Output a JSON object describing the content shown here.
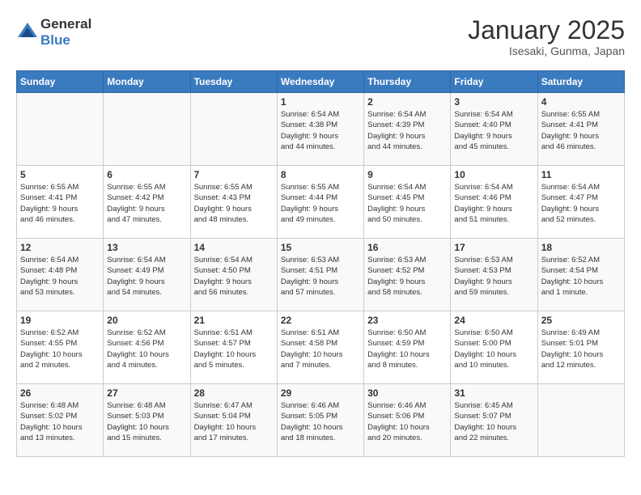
{
  "header": {
    "logo_general": "General",
    "logo_blue": "Blue",
    "title": "January 2025",
    "subtitle": "Isesaki, Gunma, Japan"
  },
  "calendar": {
    "days_of_week": [
      "Sunday",
      "Monday",
      "Tuesday",
      "Wednesday",
      "Thursday",
      "Friday",
      "Saturday"
    ],
    "weeks": [
      [
        {
          "day": "",
          "content": ""
        },
        {
          "day": "",
          "content": ""
        },
        {
          "day": "",
          "content": ""
        },
        {
          "day": "1",
          "content": "Sunrise: 6:54 AM\nSunset: 4:38 PM\nDaylight: 9 hours\nand 44 minutes."
        },
        {
          "day": "2",
          "content": "Sunrise: 6:54 AM\nSunset: 4:39 PM\nDaylight: 9 hours\nand 44 minutes."
        },
        {
          "day": "3",
          "content": "Sunrise: 6:54 AM\nSunset: 4:40 PM\nDaylight: 9 hours\nand 45 minutes."
        },
        {
          "day": "4",
          "content": "Sunrise: 6:55 AM\nSunset: 4:41 PM\nDaylight: 9 hours\nand 46 minutes."
        }
      ],
      [
        {
          "day": "5",
          "content": "Sunrise: 6:55 AM\nSunset: 4:41 PM\nDaylight: 9 hours\nand 46 minutes."
        },
        {
          "day": "6",
          "content": "Sunrise: 6:55 AM\nSunset: 4:42 PM\nDaylight: 9 hours\nand 47 minutes."
        },
        {
          "day": "7",
          "content": "Sunrise: 6:55 AM\nSunset: 4:43 PM\nDaylight: 9 hours\nand 48 minutes."
        },
        {
          "day": "8",
          "content": "Sunrise: 6:55 AM\nSunset: 4:44 PM\nDaylight: 9 hours\nand 49 minutes."
        },
        {
          "day": "9",
          "content": "Sunrise: 6:54 AM\nSunset: 4:45 PM\nDaylight: 9 hours\nand 50 minutes."
        },
        {
          "day": "10",
          "content": "Sunrise: 6:54 AM\nSunset: 4:46 PM\nDaylight: 9 hours\nand 51 minutes."
        },
        {
          "day": "11",
          "content": "Sunrise: 6:54 AM\nSunset: 4:47 PM\nDaylight: 9 hours\nand 52 minutes."
        }
      ],
      [
        {
          "day": "12",
          "content": "Sunrise: 6:54 AM\nSunset: 4:48 PM\nDaylight: 9 hours\nand 53 minutes."
        },
        {
          "day": "13",
          "content": "Sunrise: 6:54 AM\nSunset: 4:49 PM\nDaylight: 9 hours\nand 54 minutes."
        },
        {
          "day": "14",
          "content": "Sunrise: 6:54 AM\nSunset: 4:50 PM\nDaylight: 9 hours\nand 56 minutes."
        },
        {
          "day": "15",
          "content": "Sunrise: 6:53 AM\nSunset: 4:51 PM\nDaylight: 9 hours\nand 57 minutes."
        },
        {
          "day": "16",
          "content": "Sunrise: 6:53 AM\nSunset: 4:52 PM\nDaylight: 9 hours\nand 58 minutes."
        },
        {
          "day": "17",
          "content": "Sunrise: 6:53 AM\nSunset: 4:53 PM\nDaylight: 9 hours\nand 59 minutes."
        },
        {
          "day": "18",
          "content": "Sunrise: 6:52 AM\nSunset: 4:54 PM\nDaylight: 10 hours\nand 1 minute."
        }
      ],
      [
        {
          "day": "19",
          "content": "Sunrise: 6:52 AM\nSunset: 4:55 PM\nDaylight: 10 hours\nand 2 minutes."
        },
        {
          "day": "20",
          "content": "Sunrise: 6:52 AM\nSunset: 4:56 PM\nDaylight: 10 hours\nand 4 minutes."
        },
        {
          "day": "21",
          "content": "Sunrise: 6:51 AM\nSunset: 4:57 PM\nDaylight: 10 hours\nand 5 minutes."
        },
        {
          "day": "22",
          "content": "Sunrise: 6:51 AM\nSunset: 4:58 PM\nDaylight: 10 hours\nand 7 minutes."
        },
        {
          "day": "23",
          "content": "Sunrise: 6:50 AM\nSunset: 4:59 PM\nDaylight: 10 hours\nand 8 minutes."
        },
        {
          "day": "24",
          "content": "Sunrise: 6:50 AM\nSunset: 5:00 PM\nDaylight: 10 hours\nand 10 minutes."
        },
        {
          "day": "25",
          "content": "Sunrise: 6:49 AM\nSunset: 5:01 PM\nDaylight: 10 hours\nand 12 minutes."
        }
      ],
      [
        {
          "day": "26",
          "content": "Sunrise: 6:48 AM\nSunset: 5:02 PM\nDaylight: 10 hours\nand 13 minutes."
        },
        {
          "day": "27",
          "content": "Sunrise: 6:48 AM\nSunset: 5:03 PM\nDaylight: 10 hours\nand 15 minutes."
        },
        {
          "day": "28",
          "content": "Sunrise: 6:47 AM\nSunset: 5:04 PM\nDaylight: 10 hours\nand 17 minutes."
        },
        {
          "day": "29",
          "content": "Sunrise: 6:46 AM\nSunset: 5:05 PM\nDaylight: 10 hours\nand 18 minutes."
        },
        {
          "day": "30",
          "content": "Sunrise: 6:46 AM\nSunset: 5:06 PM\nDaylight: 10 hours\nand 20 minutes."
        },
        {
          "day": "31",
          "content": "Sunrise: 6:45 AM\nSunset: 5:07 PM\nDaylight: 10 hours\nand 22 minutes."
        },
        {
          "day": "",
          "content": ""
        }
      ]
    ]
  }
}
